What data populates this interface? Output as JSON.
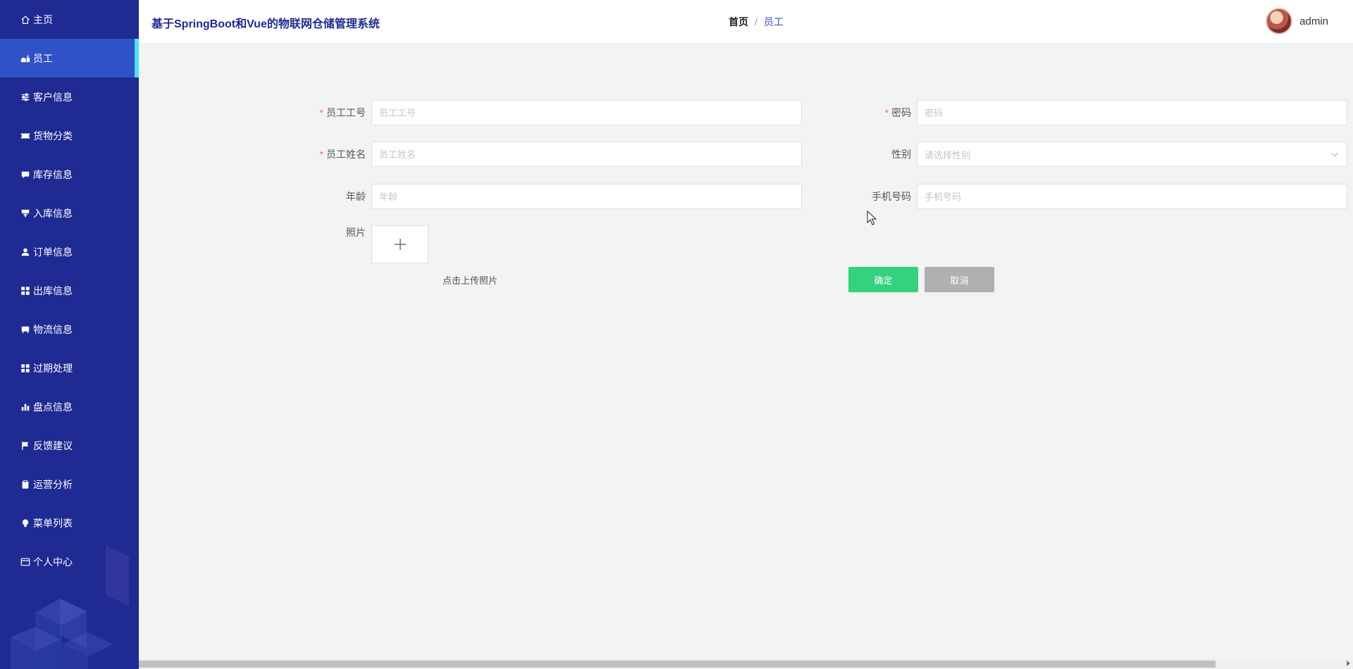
{
  "app": {
    "title": "基于SpringBoot和Vue的物联网仓储管理系统"
  },
  "breadcrumb": {
    "home": "首页",
    "separator": "/",
    "current": "员工"
  },
  "user": {
    "name": "admin"
  },
  "sidebar": {
    "items": [
      {
        "label": "主页",
        "icon": "home-icon",
        "active": false
      },
      {
        "label": "员工",
        "icon": "employee-icon",
        "active": true
      },
      {
        "label": "客户信息",
        "icon": "sliders-icon",
        "active": false
      },
      {
        "label": "货物分类",
        "icon": "ticket-icon",
        "active": false
      },
      {
        "label": "库存信息",
        "icon": "comment-icon",
        "active": false
      },
      {
        "label": "入库信息",
        "icon": "inbox-icon",
        "active": false
      },
      {
        "label": "订单信息",
        "icon": "user-icon",
        "active": false
      },
      {
        "label": "出库信息",
        "icon": "grid-icon",
        "active": false
      },
      {
        "label": "物流信息",
        "icon": "truck-icon",
        "active": false
      },
      {
        "label": "过期处理",
        "icon": "grid-icon",
        "active": false
      },
      {
        "label": "盘点信息",
        "icon": "bar-chart-icon",
        "active": false
      },
      {
        "label": "反馈建议",
        "icon": "flag-icon",
        "active": false
      },
      {
        "label": "运营分析",
        "icon": "clipboard-icon",
        "active": false
      },
      {
        "label": "菜单列表",
        "icon": "lightbulb-icon",
        "active": false
      },
      {
        "label": "个人中心",
        "icon": "card-icon",
        "active": false
      }
    ]
  },
  "form": {
    "employee_id": {
      "label": "员工工号",
      "placeholder": "员工工号",
      "required": true
    },
    "password": {
      "label": "密码",
      "placeholder": "密码",
      "required": true
    },
    "employee_name": {
      "label": "员工姓名",
      "placeholder": "员工姓名",
      "required": true
    },
    "gender": {
      "label": "性别",
      "placeholder": "请选择性别",
      "required": false
    },
    "age": {
      "label": "年龄",
      "placeholder": "年龄",
      "required": false
    },
    "phone": {
      "label": "手机号码",
      "placeholder": "手机号码",
      "required": false
    },
    "photo": {
      "label": "照片",
      "tip": "点击上传照片"
    },
    "required_mark": "*"
  },
  "buttons": {
    "ok": "确定",
    "cancel": "取消"
  },
  "colors": {
    "sidebar_bg": "#1f2a92",
    "sidebar_active": "#2f52c9",
    "active_indicator": "#4be3f5",
    "ok_button": "#34d27f",
    "cancel_button": "#aeb0b2",
    "required": "#f56c6c"
  }
}
